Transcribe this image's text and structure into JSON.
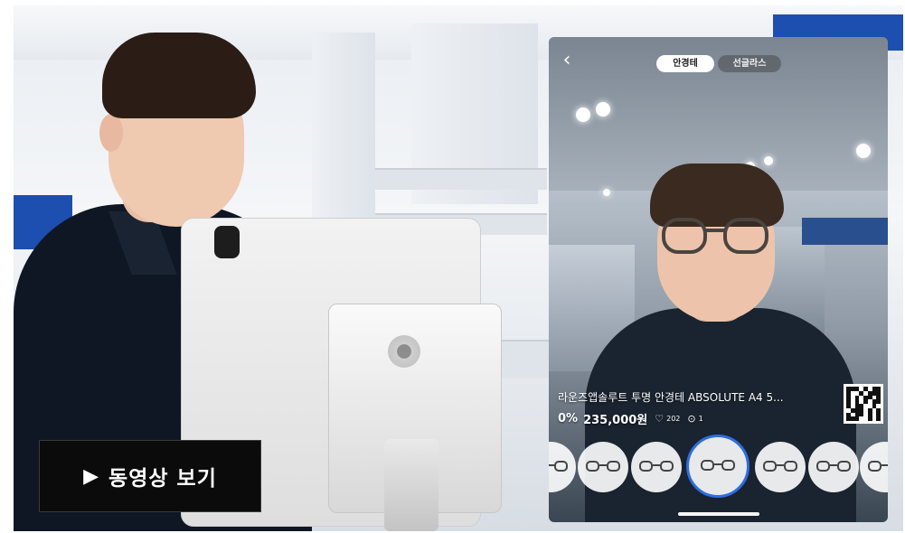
{
  "video_button": {
    "play_icon": "▶",
    "label": "동영상 보기"
  },
  "app": {
    "back_icon": "chevron-left-icon",
    "tabs": [
      {
        "label": "안경테",
        "active": true
      },
      {
        "label": "선글라스",
        "active": false
      }
    ],
    "product": {
      "name": "라운즈앱솔루트 투명 안경테 ABSOLUTE A4 5...",
      "discount": "0%",
      "price": "235,000원",
      "likes": "202",
      "views": "1"
    },
    "carousel": {
      "item_count": 7,
      "selected_index": 3
    }
  },
  "colors": {
    "selected_ring": "#2f6de0",
    "button_bg": "#0b0b0b"
  }
}
